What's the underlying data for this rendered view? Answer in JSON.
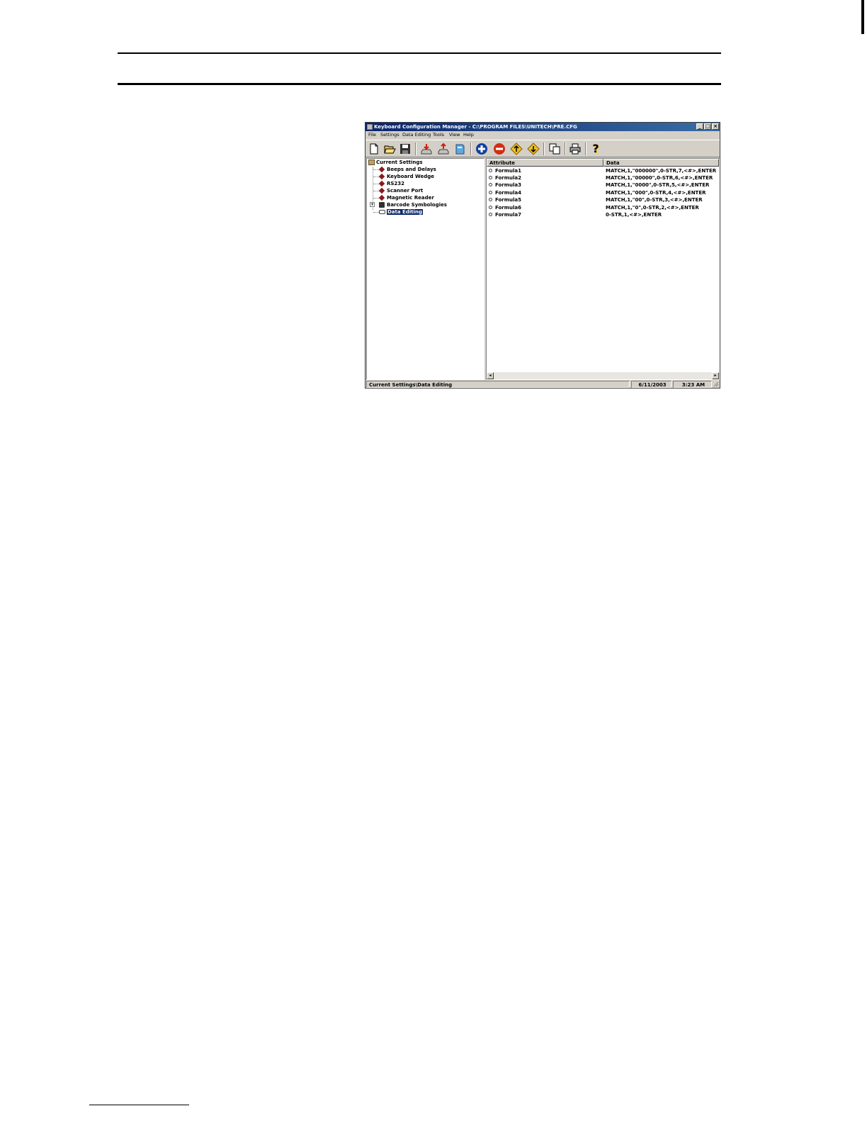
{
  "window": {
    "title": "Keyboard Configuration Manager - C:\\PROGRAM FILES\\UNITECH\\PRE.CFG",
    "controls": {
      "minimize": "_",
      "maximize": "□",
      "close": "×"
    }
  },
  "menu": [
    "File",
    "Settings",
    "Data Editing",
    "Tools",
    "View",
    "Help"
  ],
  "toolbar": {
    "icons": [
      "new-file-icon",
      "open-folder-icon",
      "save-icon",
      "download-icon",
      "upload-icon",
      "notebook-icon",
      "add-icon",
      "remove-icon",
      "move-up-icon",
      "move-down-icon",
      "copy-icon",
      "print-icon",
      "help-icon"
    ],
    "help_label": "?"
  },
  "tree": {
    "root": "Current Settings",
    "items": [
      {
        "label": "Beeps and Delays"
      },
      {
        "label": "Keyboard Wedge"
      },
      {
        "label": "RS232"
      },
      {
        "label": "Scanner Port"
      },
      {
        "label": "Magnetic Reader"
      },
      {
        "label": "Barcode Symbologies",
        "expander": "+"
      },
      {
        "label": "Data Editing",
        "selected": true
      }
    ]
  },
  "list": {
    "columns": [
      "Attribute",
      "Data"
    ],
    "rows": [
      {
        "attr": "Formula1",
        "data": "MATCH,1,\"000000\",0-STR,7,<#>,ENTER"
      },
      {
        "attr": "Formula2",
        "data": "MATCH,1,\"00000\",0-STR,6,<#>,ENTER"
      },
      {
        "attr": "Formula3",
        "data": "MATCH,1,\"0000\",0-STR,5,<#>,ENTER"
      },
      {
        "attr": "Formula4",
        "data": "MATCH,1,\"000\",0-STR,4,<#>,ENTER"
      },
      {
        "attr": "Formula5",
        "data": "MATCH,1,\"00\",0-STR,3,<#>,ENTER"
      },
      {
        "attr": "Formula6",
        "data": "MATCH,1,\"0\",0-STR,2,<#>,ENTER"
      },
      {
        "attr": "Formula7",
        "data": "0-STR,1,<#>,ENTER"
      }
    ],
    "scroll_left": "◂",
    "scroll_right": "▸"
  },
  "status": {
    "path": "Current Settings\\Data Editing",
    "date": "6/11/2003",
    "time": "3:23 AM"
  },
  "colors": {
    "title_bar": "#0a246a",
    "window_face": "#d4d0c8",
    "selection": "#0a246a"
  }
}
